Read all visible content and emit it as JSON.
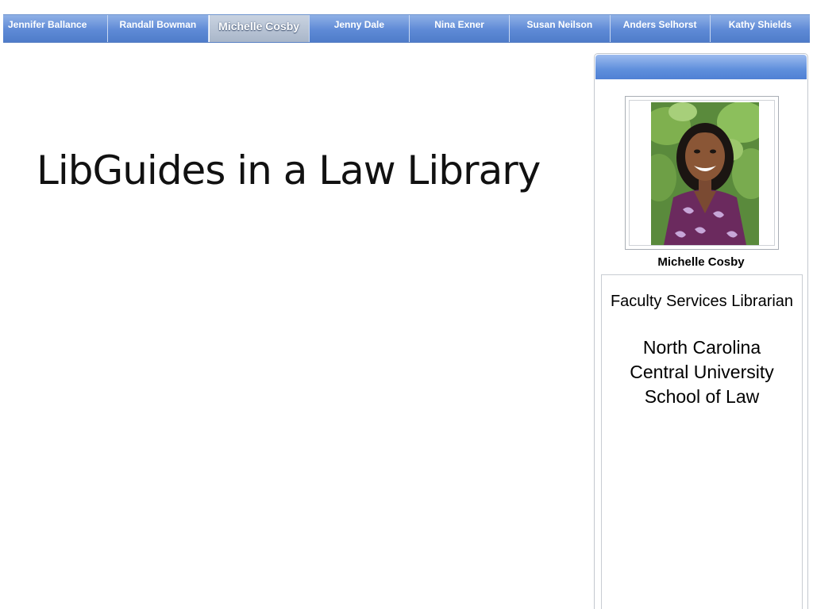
{
  "tabs": [
    {
      "label": "Jennifer Ballance",
      "active": false
    },
    {
      "label": "Randall Bowman",
      "active": false
    },
    {
      "label": "Michelle Cosby",
      "active": true
    },
    {
      "label": "Jenny Dale",
      "active": false
    },
    {
      "label": "Nina Exner",
      "active": false
    },
    {
      "label": "Susan Neilson",
      "active": false
    },
    {
      "label": "Anders Selhorst",
      "active": false
    },
    {
      "label": "Kathy Shields",
      "active": false
    }
  ],
  "slide": {
    "title": "LibGuides in a Law Library"
  },
  "profile": {
    "name": "Michelle Cosby",
    "role": "Faculty Services Librarian",
    "school": "North Carolina Central University School of Law"
  },
  "colors": {
    "tab_blue": "#5e8ad6",
    "active_tab": "#b7c2d2",
    "header_blue": "#5f8fdc"
  }
}
